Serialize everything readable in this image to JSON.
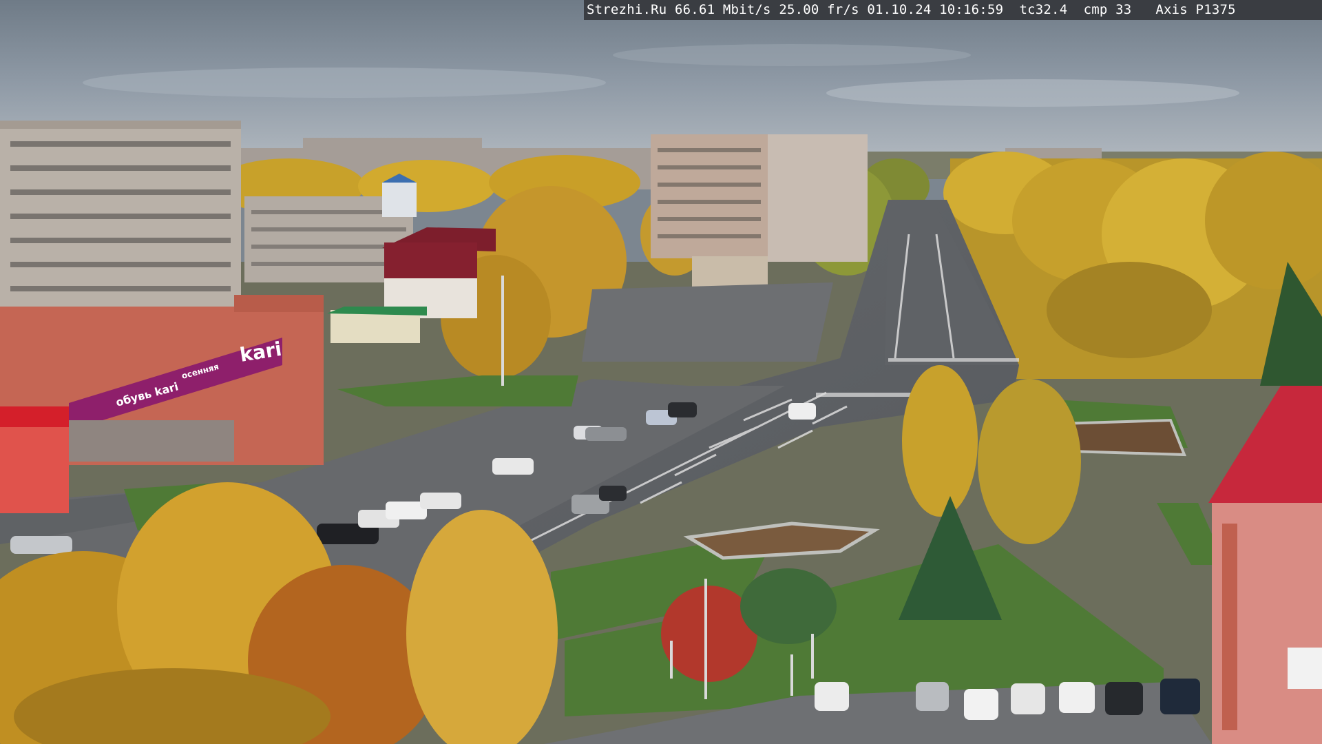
{
  "overlay": {
    "text": "Strezhi.Ru 66.61 Mbit/s 25.00 fr/s 01.10.24 10:16:59  tc32.4  cmp 33   Axis P1375"
  },
  "scene": {
    "sign_kari": "kari",
    "sign_small": "осенняя",
    "sign_sub": "обувь kari"
  },
  "palette": {
    "sky": "#8b96a1",
    "foliage": "#c9a227",
    "road": "#5c5f63",
    "building_pink": "#c76754",
    "kari_purple": "#8e1f6b"
  }
}
